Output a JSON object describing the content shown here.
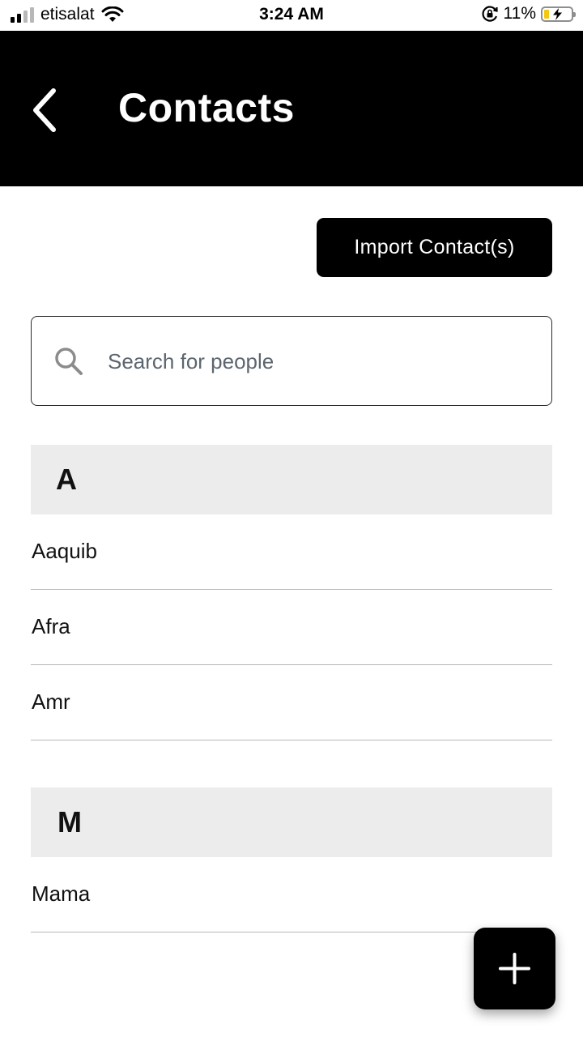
{
  "status_bar": {
    "carrier": "etisalat",
    "time": "3:24 AM",
    "battery_percent": "11%",
    "battery_level": 0.11,
    "icons": [
      "signal-icon",
      "wifi-icon",
      "rotation-lock-icon",
      "battery-charging-icon"
    ]
  },
  "header": {
    "title": "Contacts",
    "back_icon": "chevron-left-icon"
  },
  "actions": {
    "import_label": "Import Contact(s)",
    "add_icon": "plus-icon"
  },
  "search": {
    "placeholder": "Search for people",
    "value": "",
    "icon": "search-icon"
  },
  "sections": [
    {
      "letter": "A",
      "contacts": [
        "Aaquib",
        "Afra",
        "Amr"
      ]
    },
    {
      "letter": "M",
      "contacts": [
        "Mama"
      ]
    }
  ],
  "colors": {
    "header_bg": "#000000",
    "section_bg": "#ececec",
    "divider": "#b8b8b8",
    "battery_fill": "#f2c811"
  }
}
